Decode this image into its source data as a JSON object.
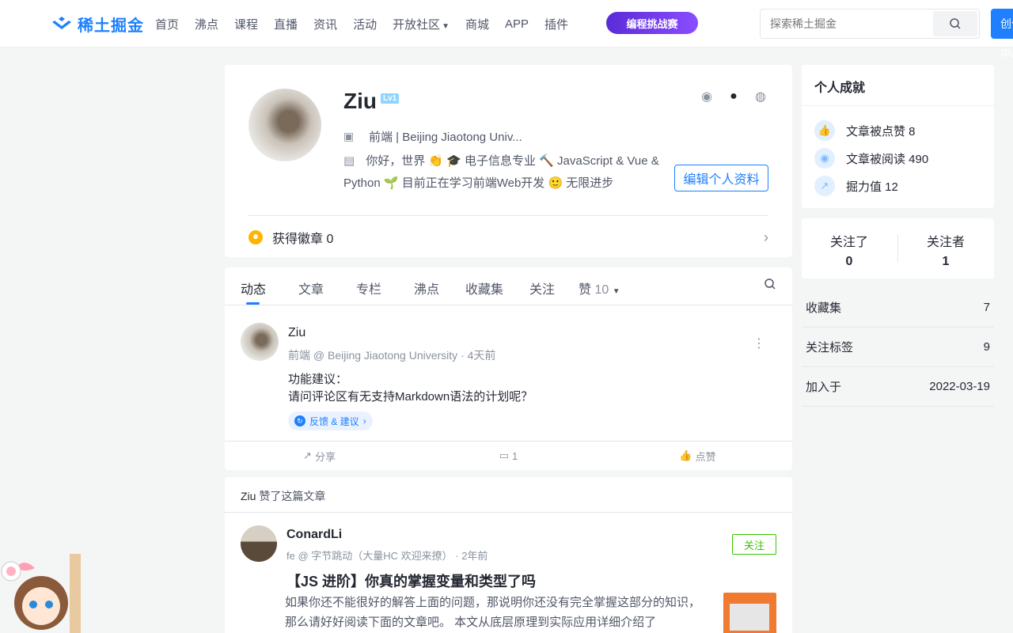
{
  "nav": {
    "logo": "稀土掘金",
    "items": [
      "首页",
      "沸点",
      "课程",
      "直播",
      "资讯",
      "活动",
      "开放社区",
      "商城",
      "APP",
      "插件"
    ],
    "promo": "编程挑战赛",
    "search_placeholder": "探索稀土掘金",
    "create": "创作者中心"
  },
  "profile": {
    "name": "Ziu",
    "level": "Lv1",
    "job": "前端 | Beijing Jiaotong Univ...",
    "bio": "你好，世界 👏 🎓 电子信息专业 🔨 JavaScript & Vue & Python 🌱 目前正在学习前端Web开发 🙂 无限进步",
    "edit_button": "编辑个人资料",
    "badges": "获得徽章 0"
  },
  "tabs": {
    "items": [
      "动态",
      "文章",
      "专栏",
      "沸点",
      "收藏集",
      "关注",
      "赞"
    ],
    "like_count": "10",
    "active": "动态"
  },
  "post": {
    "author": "Ziu",
    "meta": "前端 @ Beijing Jiaotong University · 4天前",
    "line1": "功能建议：",
    "line2": "请问评论区有无支持Markdown语法的计划呢？",
    "tag": "反馈 & 建议",
    "share": "分享",
    "comments": "1",
    "like": "点赞"
  },
  "liked": {
    "who": "Ziu",
    "action": " 赞了这篇文章",
    "author": "ConardLi",
    "meta": "fe @ 字节跳动（大量HC 欢迎来撩） · 2年前",
    "follow": "关注",
    "title": "【JS 进阶】你真的掌握变量和类型了吗",
    "abstract": "如果你还不能很好的解答上面的问题，那说明你还没有完全掌握这部分的知识，那么请好好阅读下面的文章吧。 本文从底层原理到实际应用详细介绍了"
  },
  "achievements": {
    "title": "个人成就",
    "likes": "文章被点赞 8",
    "reads": "文章被阅读 490",
    "power": "掘力值 12"
  },
  "follows": {
    "following_label": "关注了",
    "following": "0",
    "followers_label": "关注者",
    "followers": "1"
  },
  "meta": [
    {
      "label": "收藏集",
      "value": "7"
    },
    {
      "label": "关注标签",
      "value": "9"
    },
    {
      "label": "加入于",
      "value": "2022-03-19"
    }
  ],
  "colors": {
    "accent": "#1e80ff",
    "follow": "#37c700",
    "badge": "#ffb400"
  }
}
